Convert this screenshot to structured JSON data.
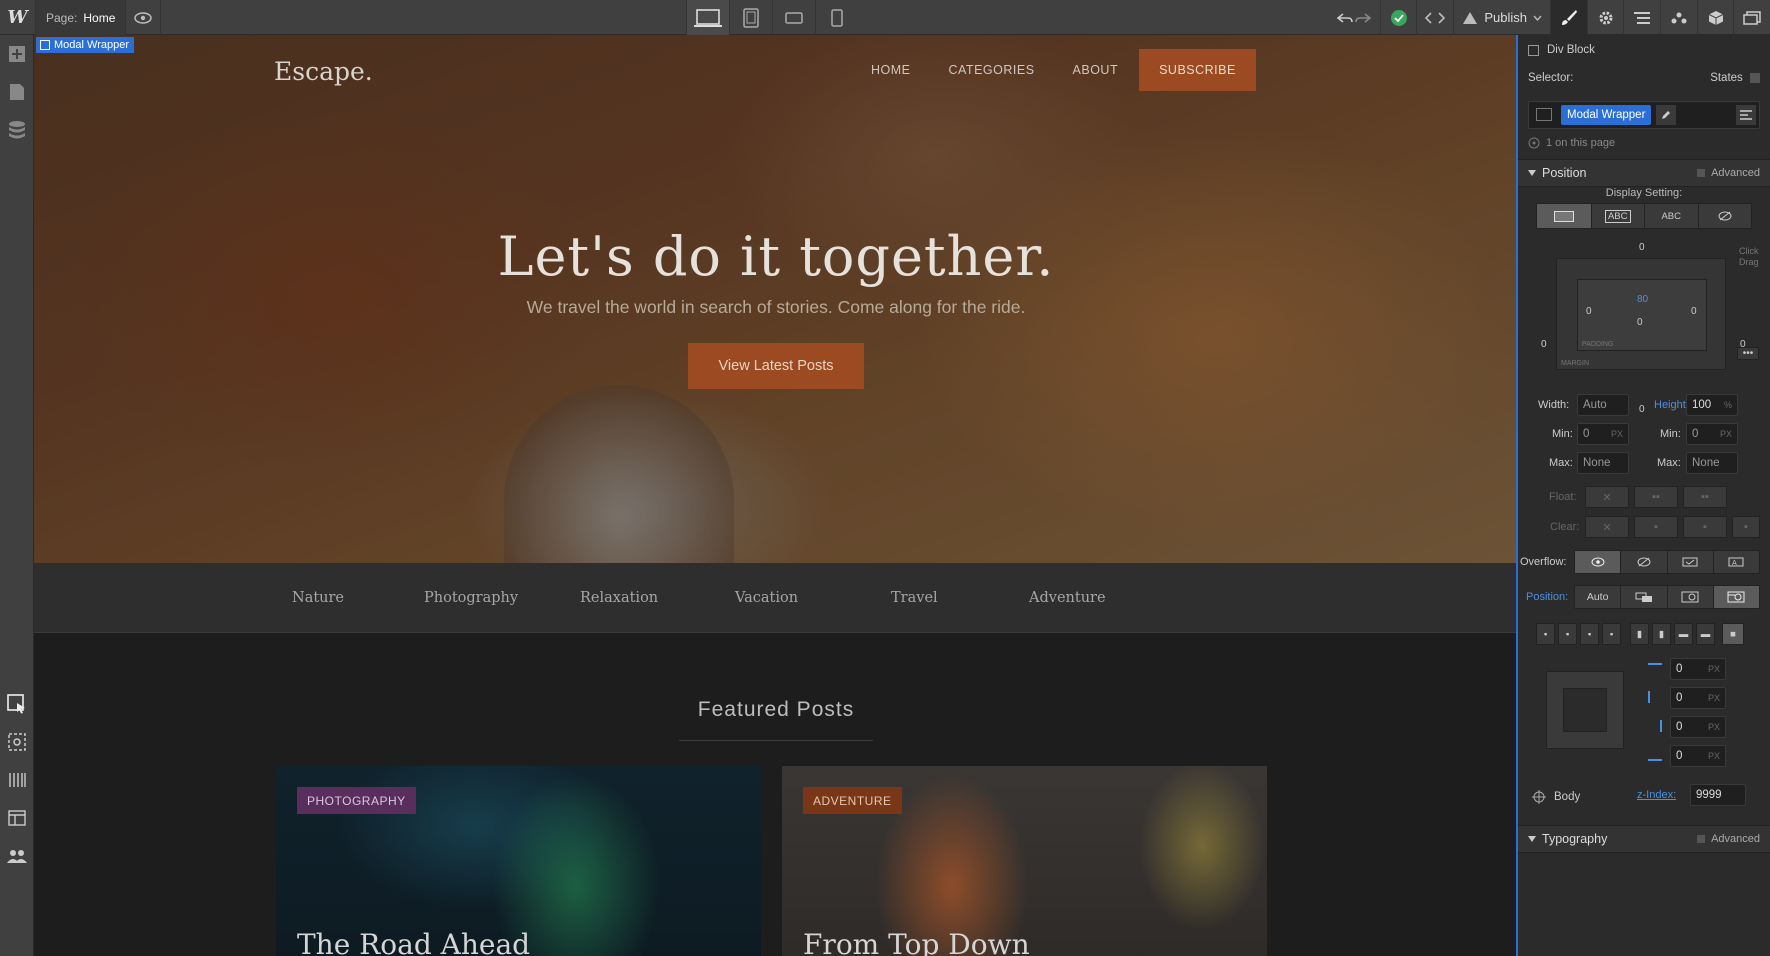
{
  "toolbar": {
    "logo": "W",
    "page_label": "Page:",
    "page_value": "Home",
    "publish_label": "Publish"
  },
  "canvas": {
    "selection_tag": "Modal Wrapper",
    "brand": "Escape.",
    "nav": [
      "HOME",
      "CATEGORIES",
      "ABOUT"
    ],
    "subscribe": "SUBSCRIBE",
    "hero_title": "Let's do it together.",
    "hero_subtitle": "We travel the world in search of stories. Come along for the ride.",
    "hero_cta": "View Latest Posts",
    "categories": [
      "Nature",
      "Photography",
      "Relaxation",
      "Vacation",
      "Travel",
      "Adventure"
    ],
    "featured_heading": "Featured Posts",
    "cards": [
      {
        "tag": "PHOTOGRAPHY",
        "title": "The Road Ahead"
      },
      {
        "tag": "ADVENTURE",
        "title": "From Top Down"
      }
    ]
  },
  "panel": {
    "element_type": "Div Block",
    "selector_label": "Selector:",
    "states_label": "States",
    "selector_chip": "Modal Wrapper",
    "on_page": "1 on this page",
    "position_section": "Position",
    "advanced_label": "Advanced",
    "display_setting": "Display Setting:",
    "display_abc1": "ABC",
    "display_abc2": "ABC",
    "box_model": {
      "margin_top": "0",
      "margin_left": "0",
      "margin_right": "0",
      "margin_bottom": "0",
      "padding_top": "80",
      "padding_left": "0",
      "padding_right": "0",
      "padding_bottom": "0",
      "center": "0",
      "padding_label": "PADDING",
      "margin_label": "MARGIN",
      "click_hint": "Click Drag"
    },
    "width_label": "Width:",
    "width_value": "Auto",
    "height_label": "Height:",
    "height_value": "100",
    "height_unit": "%",
    "min_label": "Min:",
    "min_w": "0",
    "min_h": "0",
    "min_unit": "PX",
    "max_label": "Max:",
    "max_w": "None",
    "max_h": "None",
    "float_label": "Float:",
    "clear_label": "Clear:",
    "overflow_label": "Overflow:",
    "position_label": "Position:",
    "position_value": "Auto",
    "offsets": [
      "0",
      "0",
      "0",
      "0"
    ],
    "offset_unit": "PX",
    "body_label": "Body",
    "zindex_label": "z-Index:",
    "zindex_value": "9999",
    "typography_section": "Typography"
  },
  "colors": {
    "accent": "#2b6fd6",
    "cta": "#9c4a22",
    "tag_photography": "#5a2e5c",
    "tag_adventure": "#7a3718",
    "publish_check": "#3aa65c"
  }
}
